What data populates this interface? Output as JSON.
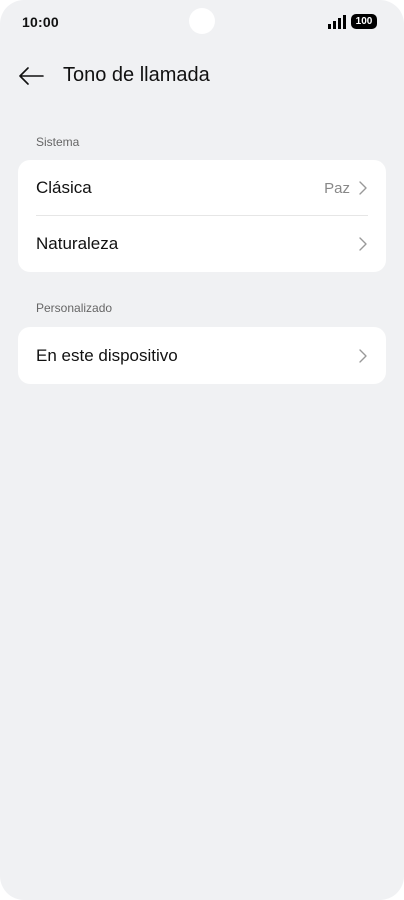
{
  "status_bar": {
    "time": "10:00",
    "battery": "100",
    "icons": [
      "signal-icon",
      "battery-icon"
    ]
  },
  "header": {
    "back_icon": "arrow-left-icon",
    "title": "Tono de llamada"
  },
  "sections": [
    {
      "label": "Sistema",
      "items": [
        {
          "label": "Clásica",
          "value": "Paz",
          "icon": "chevron-right-icon"
        },
        {
          "label": "Naturaleza",
          "value": "",
          "icon": "chevron-right-icon"
        }
      ]
    },
    {
      "label": "Personalizado",
      "items": [
        {
          "label": "En este dispositivo",
          "value": "",
          "icon": "chevron-right-icon"
        }
      ]
    }
  ],
  "colors": {
    "background": "#f0f1f3",
    "card": "#ffffff",
    "primary_text": "#111111",
    "secondary_text": "#888888"
  }
}
